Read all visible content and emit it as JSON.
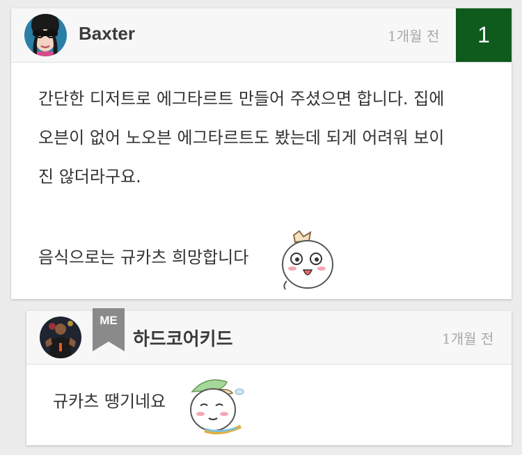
{
  "comment": {
    "author": "Baxter",
    "time": "1개월 전",
    "reply_count": "1",
    "lines": [
      "간단한 디저트로 에그타르트 만들어 주셨으면 합니다. 집에",
      "오븐이 없어 노오븐 에그타르트도 봤는데 되게 어려워 보이",
      "진 않더라구요.",
      "음식으로는 규카츠 희망합니다"
    ],
    "avatar_icon": "user-avatar-photo",
    "emoji_icon": "pleading-face-sticker"
  },
  "reply": {
    "author": "하드코어키드",
    "me_label": "ME",
    "time": "1개월 전",
    "text": "규카츠 땡기네요",
    "avatar_icon": "player-avatar-photo",
    "emoji_icon": "shy-sweating-sticker"
  },
  "colors": {
    "badge": "#0f5a1d",
    "me_flag": "#8a8a8a",
    "background": "#ececec"
  }
}
